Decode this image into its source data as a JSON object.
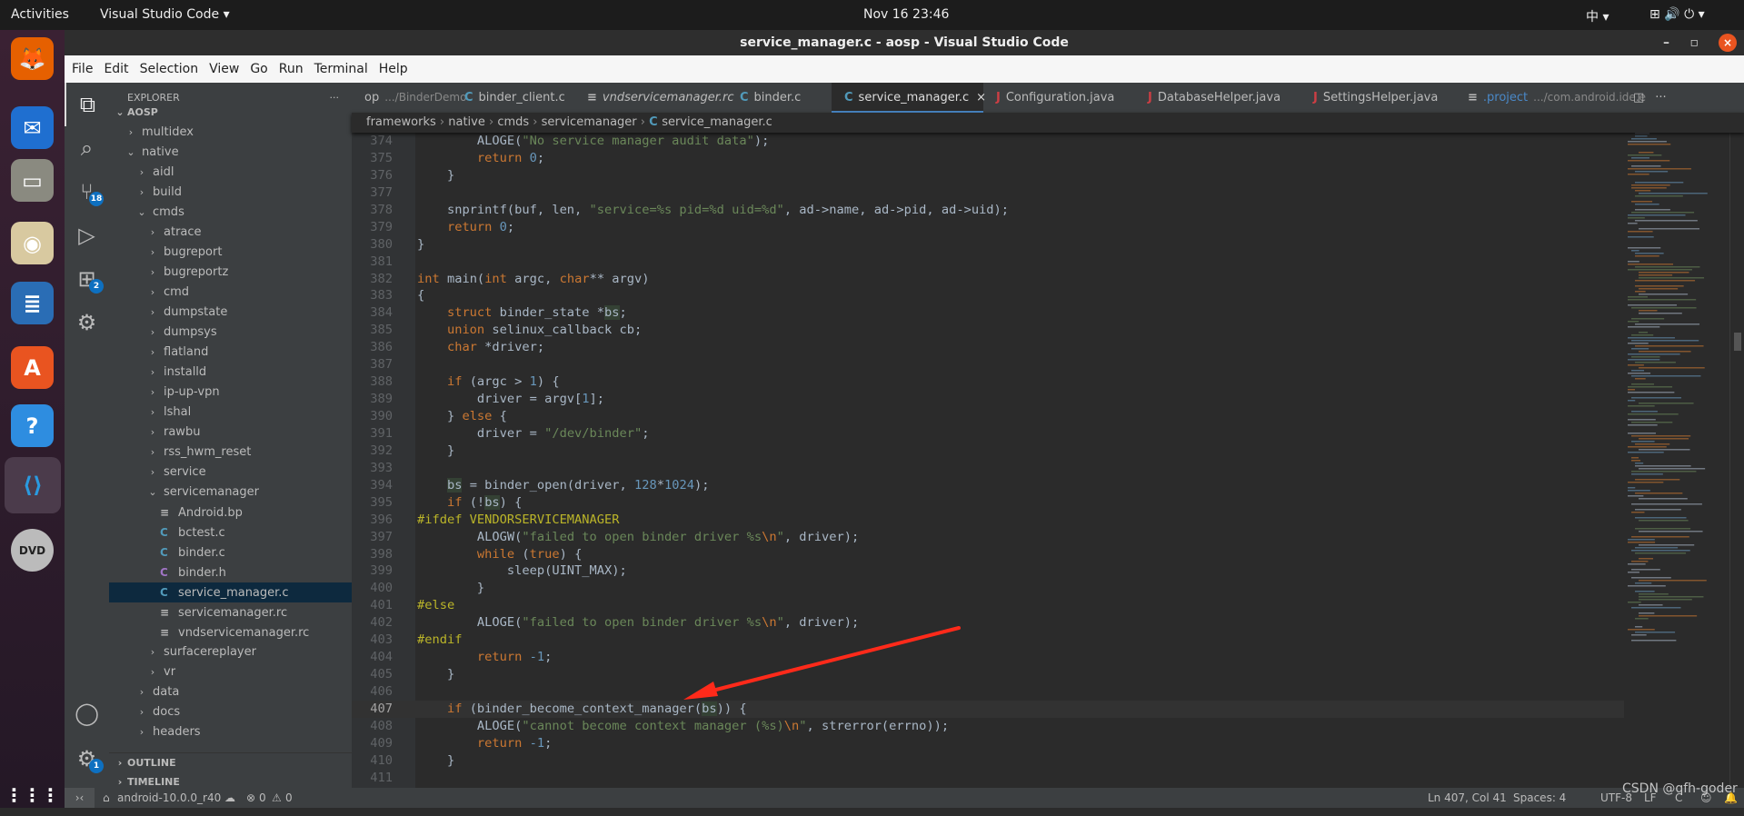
{
  "topbar": {
    "activities": "Activities",
    "app": "Visual Studio Code ▾",
    "clock": "Nov 16  23:46",
    "ime": "中 ▾",
    "tray": "⊞ 🔊 ⏻ ▾"
  },
  "dock": [
    {
      "name": "firefox",
      "color": "#e66000",
      "glyph": "🦊"
    },
    {
      "name": "thunderbird",
      "color": "#1f6fd0",
      "glyph": "✉"
    },
    {
      "name": "files",
      "color": "#8a8a80",
      "glyph": "▭"
    },
    {
      "name": "rhythmbox",
      "color": "#d8c9a0",
      "glyph": "◉"
    },
    {
      "name": "libreoffice-writer",
      "color": "#2a6db5",
      "glyph": "≣"
    },
    {
      "name": "software",
      "color": "#e95420",
      "glyph": "A"
    },
    {
      "name": "help",
      "color": "#2e8de0",
      "glyph": "?"
    },
    {
      "name": "vscode",
      "color": "#4b3b4b",
      "glyph": "⟨⟩"
    },
    {
      "name": "dvd",
      "color": "#bbbbbb",
      "glyph": "DVD"
    }
  ],
  "window": {
    "title": "service_manager.c - aosp - Visual Studio Code"
  },
  "menu": [
    "File",
    "Edit",
    "Selection",
    "View",
    "Go",
    "Run",
    "Terminal",
    "Help"
  ],
  "activity": {
    "scm_badge": "18",
    "extensions_badge": "2",
    "settings_badge": "1"
  },
  "sidebar": {
    "title": "EXPLORER",
    "more": "···",
    "root": "AOSP",
    "items": [
      {
        "label": "multidex",
        "depth": 1,
        "type": "folder",
        "open": false
      },
      {
        "label": "native",
        "depth": 1,
        "type": "folder",
        "open": true
      },
      {
        "label": "aidl",
        "depth": 2,
        "type": "folder",
        "open": false
      },
      {
        "label": "build",
        "depth": 2,
        "type": "folder",
        "open": false
      },
      {
        "label": "cmds",
        "depth": 2,
        "type": "folder",
        "open": true
      },
      {
        "label": "atrace",
        "depth": 3,
        "type": "folder",
        "open": false
      },
      {
        "label": "bugreport",
        "depth": 3,
        "type": "folder",
        "open": false
      },
      {
        "label": "bugreportz",
        "depth": 3,
        "type": "folder",
        "open": false
      },
      {
        "label": "cmd",
        "depth": 3,
        "type": "folder",
        "open": false
      },
      {
        "label": "dumpstate",
        "depth": 3,
        "type": "folder",
        "open": false
      },
      {
        "label": "dumpsys",
        "depth": 3,
        "type": "folder",
        "open": false
      },
      {
        "label": "flatland",
        "depth": 3,
        "type": "folder",
        "open": false
      },
      {
        "label": "installd",
        "depth": 3,
        "type": "folder",
        "open": false
      },
      {
        "label": "ip-up-vpn",
        "depth": 3,
        "type": "folder",
        "open": false
      },
      {
        "label": "lshal",
        "depth": 3,
        "type": "folder",
        "open": false
      },
      {
        "label": "rawbu",
        "depth": 3,
        "type": "folder",
        "open": false
      },
      {
        "label": "rss_hwm_reset",
        "depth": 3,
        "type": "folder",
        "open": false
      },
      {
        "label": "service",
        "depth": 3,
        "type": "folder",
        "open": false
      },
      {
        "label": "servicemanager",
        "depth": 3,
        "type": "folder",
        "open": true
      },
      {
        "label": "Android.bp",
        "depth": 4,
        "type": "text"
      },
      {
        "label": "bctest.c",
        "depth": 4,
        "type": "c"
      },
      {
        "label": "binder.c",
        "depth": 4,
        "type": "c"
      },
      {
        "label": "binder.h",
        "depth": 4,
        "type": "h"
      },
      {
        "label": "service_manager.c",
        "depth": 4,
        "type": "c",
        "selected": true
      },
      {
        "label": "servicemanager.rc",
        "depth": 4,
        "type": "text"
      },
      {
        "label": "vndservicemanager.rc",
        "depth": 4,
        "type": "text"
      },
      {
        "label": "surfacereplayer",
        "depth": 3,
        "type": "folder",
        "open": false
      },
      {
        "label": "vr",
        "depth": 3,
        "type": "folder",
        "open": false
      },
      {
        "label": "data",
        "depth": 2,
        "type": "folder",
        "open": false
      },
      {
        "label": "docs",
        "depth": 2,
        "type": "folder",
        "open": false
      },
      {
        "label": "headers",
        "depth": 2,
        "type": "folder",
        "open": false
      }
    ],
    "outline": "OUTLINE",
    "timeline": "TIMELINE"
  },
  "tabs": [
    {
      "label": "op",
      "desc": ".../BinderDemo",
      "icon": "none",
      "w": 110
    },
    {
      "label": "binder_client.c",
      "icon": "c",
      "w": 135
    },
    {
      "label": "vndservicemanager.rc",
      "icon": "text",
      "italic": true,
      "w": 168
    },
    {
      "label": "binder.c",
      "icon": "c",
      "w": 115
    },
    {
      "label": "service_manager.c",
      "icon": "c",
      "active": true,
      "close": "×",
      "w": 167
    },
    {
      "label": "Configuration.java",
      "icon": "java",
      "w": 167
    },
    {
      "label": "DatabaseHelper.java",
      "icon": "java",
      "w": 182
    },
    {
      "label": "SettingsHelper.java",
      "icon": "java",
      "w": 170
    },
    {
      "label": ".project",
      "desc": ".../com.android.ide.e",
      "icon": "text",
      "w": 190
    }
  ],
  "tab_actions": {
    "split": "◫",
    "more": "···"
  },
  "breadcrumb": [
    "frameworks",
    "native",
    "cmds",
    "servicemanager",
    "service_manager.c"
  ],
  "editor": {
    "current_line": 407,
    "lines": [
      {
        "n": 374,
        "t": [
          [
            "t",
            "        ALOGE("
          ],
          [
            "s",
            "\"No service manager audit data\""
          ],
          [
            "t",
            ");"
          ]
        ]
      },
      {
        "n": 375,
        "t": [
          [
            "k",
            "        return "
          ],
          [
            "n",
            "0"
          ],
          [
            "t",
            ";"
          ]
        ]
      },
      {
        "n": 376,
        "t": [
          [
            "t",
            "    }"
          ]
        ]
      },
      {
        "n": 377,
        "t": []
      },
      {
        "n": 378,
        "t": [
          [
            "t",
            "    snprintf(buf, len, "
          ],
          [
            "s",
            "\"service=%s pid=%d uid=%d\""
          ],
          [
            "t",
            ", ad->name, ad->pid, ad->uid);"
          ]
        ]
      },
      {
        "n": 379,
        "t": [
          [
            "k",
            "    return "
          ],
          [
            "n",
            "0"
          ],
          [
            "t",
            ";"
          ]
        ]
      },
      {
        "n": 380,
        "t": [
          [
            "t",
            "}"
          ]
        ]
      },
      {
        "n": 381,
        "t": []
      },
      {
        "n": 382,
        "t": [
          [
            "k",
            "int"
          ],
          [
            "t",
            " main("
          ],
          [
            "k",
            "int"
          ],
          [
            "t",
            " argc, "
          ],
          [
            "k",
            "char"
          ],
          [
            "t",
            "** argv)"
          ]
        ]
      },
      {
        "n": 383,
        "t": [
          [
            "t",
            "{"
          ]
        ]
      },
      {
        "n": 384,
        "t": [
          [
            "k",
            "    struct"
          ],
          [
            "t",
            " binder_state *"
          ],
          [
            "h",
            "bs"
          ],
          [
            "t",
            ";"
          ]
        ]
      },
      {
        "n": 385,
        "t": [
          [
            "k",
            "    union"
          ],
          [
            "t",
            " selinux_callback cb;"
          ]
        ]
      },
      {
        "n": 386,
        "t": [
          [
            "k",
            "    char"
          ],
          [
            "t",
            " *driver;"
          ]
        ]
      },
      {
        "n": 387,
        "t": []
      },
      {
        "n": 388,
        "t": [
          [
            "k",
            "    if"
          ],
          [
            "t",
            " (argc > "
          ],
          [
            "n",
            "1"
          ],
          [
            "t",
            ") {"
          ]
        ]
      },
      {
        "n": 389,
        "t": [
          [
            "t",
            "        driver = argv["
          ],
          [
            "n",
            "1"
          ],
          [
            "t",
            "];"
          ]
        ]
      },
      {
        "n": 390,
        "t": [
          [
            "t",
            "    } "
          ],
          [
            "k",
            "else"
          ],
          [
            "t",
            " {"
          ]
        ]
      },
      {
        "n": 391,
        "t": [
          [
            "t",
            "        driver = "
          ],
          [
            "s",
            "\"/dev/binder\""
          ],
          [
            "t",
            ";"
          ]
        ]
      },
      {
        "n": 392,
        "t": [
          [
            "t",
            "    }"
          ]
        ]
      },
      {
        "n": 393,
        "t": []
      },
      {
        "n": 394,
        "t": [
          [
            "h",
            "    bs"
          ],
          [
            "t",
            " = binder_open(driver, "
          ],
          [
            "n",
            "128"
          ],
          [
            "t",
            "*"
          ],
          [
            "n",
            "1024"
          ],
          [
            "t",
            ");"
          ]
        ]
      },
      {
        "n": 395,
        "t": [
          [
            "k",
            "    if"
          ],
          [
            "t",
            " (!"
          ],
          [
            "h",
            "bs"
          ],
          [
            "t",
            ") {"
          ]
        ]
      },
      {
        "n": 396,
        "t": [
          [
            "p",
            "#ifdef VENDORSERVICEMANAGER"
          ]
        ]
      },
      {
        "n": 397,
        "t": [
          [
            "t",
            "        ALOGW("
          ],
          [
            "s",
            "\"failed to open binder driver %s"
          ],
          [
            "e",
            "\\n"
          ],
          [
            "s",
            "\""
          ],
          [
            "t",
            ", driver);"
          ]
        ]
      },
      {
        "n": 398,
        "t": [
          [
            "k",
            "        while"
          ],
          [
            "t",
            " ("
          ],
          [
            "k",
            "true"
          ],
          [
            "t",
            ") {"
          ]
        ]
      },
      {
        "n": 399,
        "t": [
          [
            "t",
            "            sleep(UINT_MAX);"
          ]
        ]
      },
      {
        "n": 400,
        "t": [
          [
            "t",
            "        }"
          ]
        ]
      },
      {
        "n": 401,
        "t": [
          [
            "p",
            "#else"
          ]
        ]
      },
      {
        "n": 402,
        "t": [
          [
            "t",
            "        ALOGE("
          ],
          [
            "s",
            "\"failed to open binder driver %s"
          ],
          [
            "e",
            "\\n"
          ],
          [
            "s",
            "\""
          ],
          [
            "t",
            ", driver);"
          ]
        ]
      },
      {
        "n": 403,
        "t": [
          [
            "p",
            "#endif"
          ]
        ]
      },
      {
        "n": 404,
        "t": [
          [
            "k",
            "        return "
          ],
          [
            "n",
            "-1"
          ],
          [
            "t",
            ";"
          ]
        ]
      },
      {
        "n": 405,
        "t": [
          [
            "t",
            "    }"
          ]
        ]
      },
      {
        "n": 406,
        "t": []
      },
      {
        "n": 407,
        "t": [
          [
            "k",
            "    if"
          ],
          [
            "t",
            " (binder_become_context_manager("
          ],
          [
            "h",
            "bs"
          ],
          [
            "t",
            ")) {"
          ]
        ]
      },
      {
        "n": 408,
        "t": [
          [
            "t",
            "        ALOGE("
          ],
          [
            "s",
            "\"cannot become context manager (%s)"
          ],
          [
            "e",
            "\\n"
          ],
          [
            "s",
            "\""
          ],
          [
            "t",
            ", strerror(errno));"
          ]
        ]
      },
      {
        "n": 409,
        "t": [
          [
            "k",
            "        return "
          ],
          [
            "n",
            "-1"
          ],
          [
            "t",
            ";"
          ]
        ]
      },
      {
        "n": 410,
        "t": [
          [
            "t",
            "    }"
          ]
        ]
      },
      {
        "n": 411,
        "t": []
      }
    ]
  },
  "annotation": {
    "arrow_color": "#ff2a1a"
  },
  "status": {
    "branch": "android-10.0.0_r40",
    "errors": "0",
    "warnings": "0",
    "position": "Ln 407, Col 41",
    "spaces": "Spaces: 4",
    "encoding": "UTF-8",
    "eol": "LF"
  },
  "watermark": "CSDN @qfh-goder",
  "colors": {
    "keyword": "#cc7832",
    "string": "#6a8759",
    "number": "#6897bb",
    "text": "#a9b7c6",
    "accent": "#4a88c7"
  }
}
